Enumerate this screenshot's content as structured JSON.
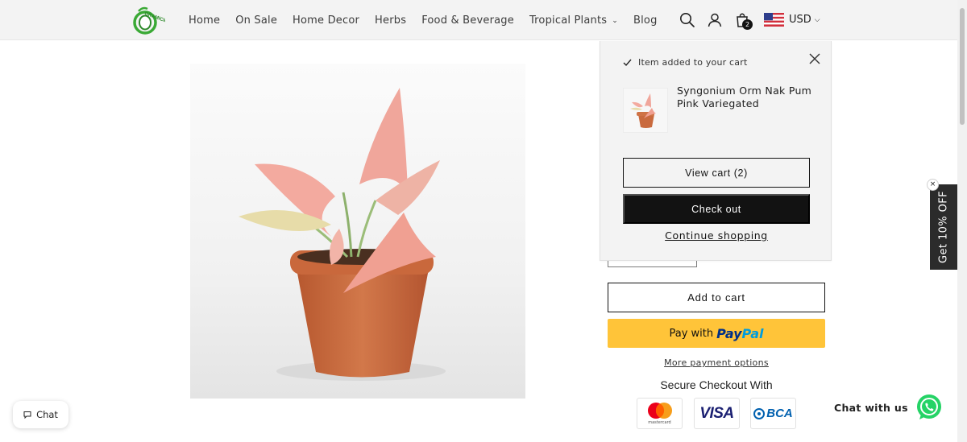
{
  "header": {
    "logo_text": "ORAMICIN",
    "nav": [
      {
        "label": "Home",
        "has_dropdown": false
      },
      {
        "label": "On Sale",
        "has_dropdown": false
      },
      {
        "label": "Home Decor",
        "has_dropdown": false
      },
      {
        "label": "Herbs",
        "has_dropdown": false
      },
      {
        "label": "Food & Beverage",
        "has_dropdown": false
      },
      {
        "label": "Tropical Plants",
        "has_dropdown": true
      },
      {
        "label": "Blog",
        "has_dropdown": false
      }
    ],
    "icons": [
      "search-icon",
      "account-icon",
      "cart-icon"
    ],
    "cart_count": "2",
    "currency": "USD"
  },
  "cart_notification": {
    "heading": "Item added to your cart",
    "product_name": "Syngonium Orm Nak Pum Pink Variegated",
    "view_cart_label": "View cart (2)",
    "checkout_label": "Check out",
    "continue_label": "Continue shopping"
  },
  "product": {
    "add_to_cart_label": "Add to cart",
    "paypal_prefix": "Pay with",
    "paypal_brand_1": "Pay",
    "paypal_brand_2": "Pal",
    "more_payment_label": "More payment options",
    "secure_checkout_title": "Secure Checkout With",
    "payment_logos": [
      {
        "name": "Mastercard",
        "text": "mastercard"
      },
      {
        "name": "Visa",
        "text": "VISA"
      },
      {
        "name": "BCA",
        "text": "BCA"
      }
    ]
  },
  "discount_tab": {
    "label": "Get 10% OFF",
    "close": "×"
  },
  "chat": {
    "label": "Chat"
  },
  "whatsapp": {
    "label": "Chat with us"
  },
  "colors": {
    "header_bg": "#f3f3f3",
    "primary_button": "#121212",
    "paypal_yellow": "#ffc439",
    "whatsapp_green": "#25d366"
  }
}
